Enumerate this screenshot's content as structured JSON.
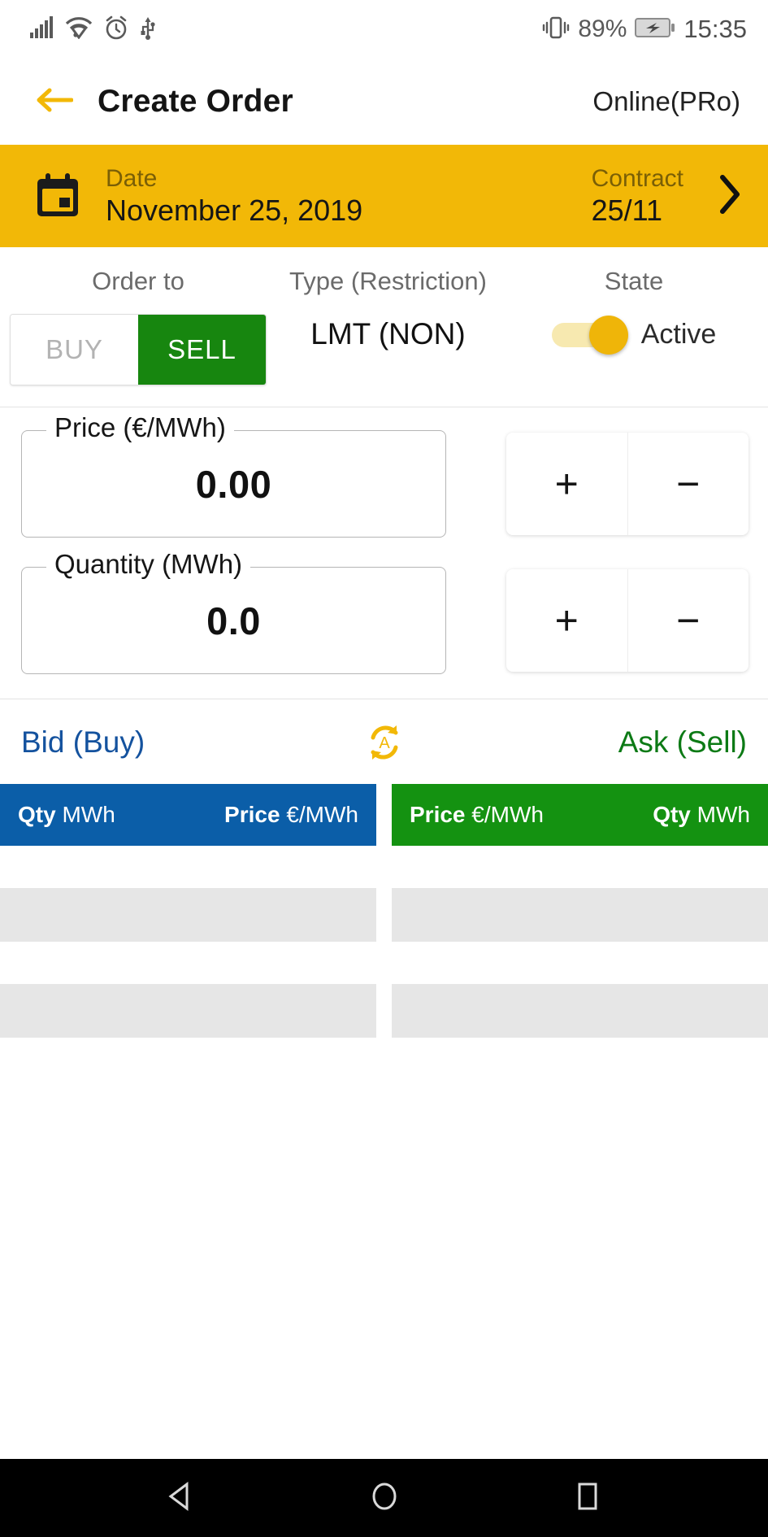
{
  "status_bar": {
    "icons": [
      "signal-icon",
      "wifi-icon",
      "alarm-icon",
      "usb-icon"
    ],
    "vibrate_icon": "vibrate-icon",
    "battery_percent": "89%",
    "battery_icon": "battery-charging-icon",
    "time": "15:35"
  },
  "app_bar": {
    "back_icon": "back-arrow-icon",
    "title": "Create Order",
    "connection": "Online(PRo)"
  },
  "date_bar": {
    "calendar_icon": "calendar-icon",
    "date_label": "Date",
    "date_value": "November 25, 2019",
    "contract_label": "Contract",
    "contract_value": "25/11",
    "chevron_icon": "chevron-right-icon"
  },
  "order": {
    "order_to_label": "Order to",
    "buy_label": "BUY",
    "sell_label": "SELL",
    "selected_side": "SELL",
    "type_label": "Type (Restriction)",
    "type_value": "LMT (NON)",
    "state_label": "State",
    "state_value": "Active",
    "state_on": true
  },
  "fields": {
    "price": {
      "legend": "Price (€/MWh)",
      "value": "0.00",
      "plus_label": "+",
      "minus_label": "−"
    },
    "quantity": {
      "legend": "Quantity (MWh)",
      "value": "0.0",
      "plus_label": "+",
      "minus_label": "−"
    }
  },
  "order_book": {
    "bid_title": "Bid (Buy)",
    "ask_title": "Ask (Sell)",
    "refresh_icon": "auto-refresh-icon",
    "bid_headers": {
      "left_bold": "Qty",
      "left_unit": "MWh",
      "right_bold": "Price",
      "right_unit": "€/MWh"
    },
    "ask_headers": {
      "left_bold": "Price",
      "left_unit": "€/MWh",
      "right_bold": "Qty",
      "right_unit": "MWh"
    },
    "bid_rows": [],
    "ask_rows": [],
    "placeholder_row_count": 2
  },
  "nav_bar": {
    "back_icon": "nav-back-icon",
    "home_icon": "nav-home-icon",
    "recents_icon": "nav-recents-icon"
  },
  "colors": {
    "accent_yellow": "#F2B807",
    "sell_green": "#17860F",
    "bid_blue": "#0B5EA8",
    "ask_green": "#149211",
    "bid_text_blue": "#14529E",
    "ask_text_green": "#0C7A15"
  }
}
